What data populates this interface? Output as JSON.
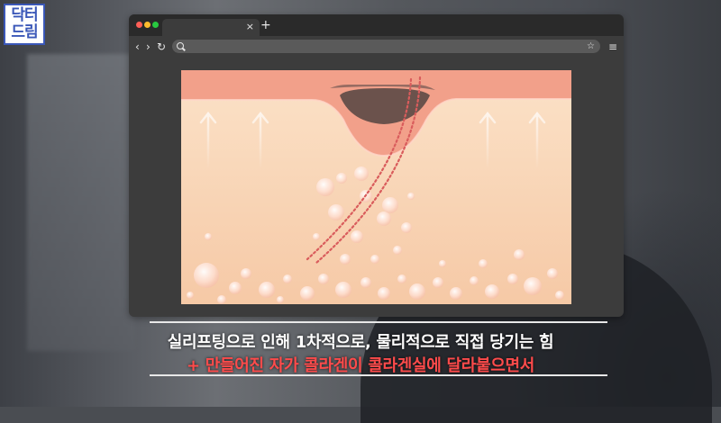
{
  "logo": {
    "line1": "닥터",
    "line2": "드림",
    "color": "#3a57b8"
  },
  "browser": {
    "tab_close": "×",
    "new_tab": "+",
    "nav": {
      "back": "‹",
      "forward": "›",
      "reload": "↻",
      "star": "☆",
      "menu": "≡"
    },
    "traffic_lights": [
      "#ff5f57",
      "#febc2e",
      "#28c840"
    ]
  },
  "illustration": {
    "skin_surface_color": "#f2a08a",
    "dermis_color": "#f8d3b3",
    "bubble_color": "#ffffff",
    "thread_color": "#d95c5c"
  },
  "subtitles": {
    "line1": "실리프팅으로 인해 1차적으로, 물리적으로 직접 당기는 힘",
    "line2": "+ 만들어진 자가 콜라겐이 콜라겐실에 달라붙으면서",
    "line1_color": "#ffffff",
    "line2_color": "#ff4b4b"
  }
}
